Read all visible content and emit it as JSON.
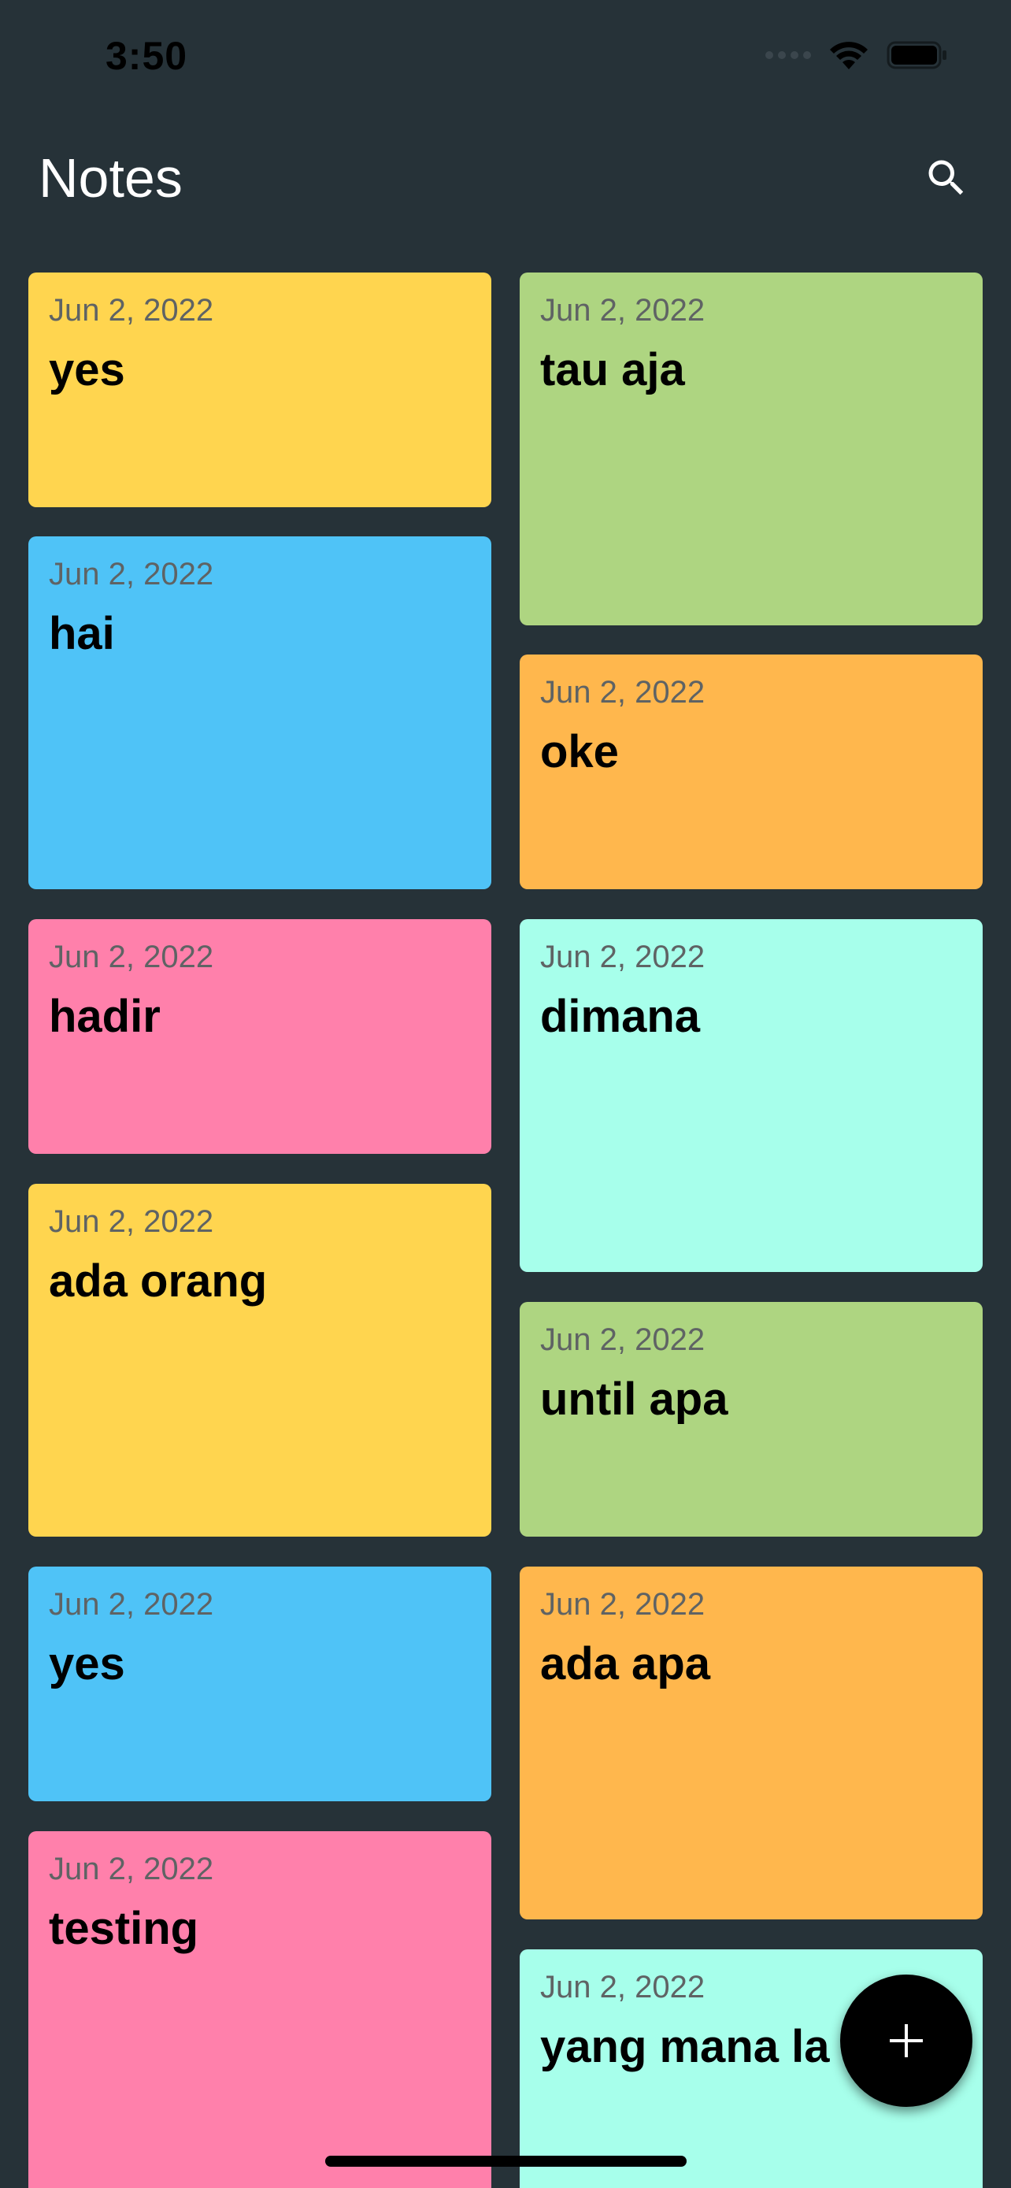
{
  "status_bar": {
    "time": "3:50"
  },
  "header": {
    "title": "Notes",
    "search_icon": "search-icon"
  },
  "notes_left": [
    {
      "date": "Jun 2, 2022",
      "title": "yes",
      "color": "#FFD54F"
    },
    {
      "date": "Jun 2, 2022",
      "title": "hai",
      "color": "#4FC3F7"
    },
    {
      "date": "Jun 2, 2022",
      "title": "hadir",
      "color": "#FF80AB"
    },
    {
      "date": "Jun 2, 2022",
      "title": "ada orang",
      "color": "#FFD54F"
    },
    {
      "date": "Jun 2, 2022",
      "title": "yes",
      "color": "#4FC3F7"
    },
    {
      "date": "Jun 2, 2022",
      "title": "testing",
      "color": "#FF80AB"
    }
  ],
  "notes_right": [
    {
      "date": "Jun 2, 2022",
      "title": "tau aja",
      "color": "#AED581"
    },
    {
      "date": "Jun 2, 2022",
      "title": "oke",
      "color": "#FFB74D"
    },
    {
      "date": "Jun 2, 2022",
      "title": "dimana",
      "color": "#A7FFEB"
    },
    {
      "date": "Jun 2, 2022",
      "title": "until apa",
      "color": "#AED581"
    },
    {
      "date": "Jun 2, 2022",
      "title": "ada apa",
      "color": "#FFB74D"
    },
    {
      "date": "Jun 2, 2022",
      "title": "yang mana la",
      "color": "#A7FFEB"
    }
  ],
  "fab": {
    "icon": "plus-icon"
  },
  "colors": {
    "background": "#263238",
    "fab": "#000000"
  }
}
